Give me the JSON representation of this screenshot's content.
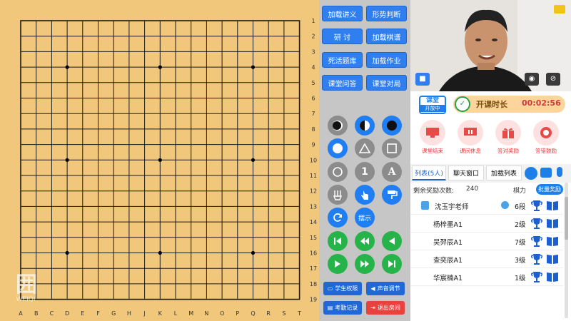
{
  "board": {
    "col_labels": [
      "A",
      "B",
      "C",
      "D",
      "E",
      "F",
      "G",
      "H",
      "J",
      "K",
      "L",
      "M",
      "N",
      "O",
      "P",
      "Q",
      "R",
      "S",
      "T"
    ],
    "row_labels": [
      "1",
      "2",
      "3",
      "4",
      "5",
      "6",
      "7",
      "8",
      "9",
      "10",
      "11",
      "12",
      "13",
      "14",
      "15",
      "16",
      "17",
      "18",
      "19"
    ],
    "star_points": [
      "D4",
      "K4",
      "Q4",
      "D10",
      "K10",
      "Q10",
      "D16",
      "K16",
      "Q16"
    ],
    "board_color": "#f1c77b",
    "line_color": "#1a1a1a"
  },
  "watermark": {
    "text": "少儿围棋",
    "sub": "WEIQI"
  },
  "tools": {
    "buttons": [
      {
        "label": "加载讲义",
        "name": "load-handout-button"
      },
      {
        "label": "形势判断",
        "name": "situation-judge-button"
      },
      {
        "label": "研 讨",
        "name": "discuss-button"
      },
      {
        "label": "加载棋谱",
        "name": "load-record-button"
      },
      {
        "label": "死活题库",
        "name": "life-death-bank-button"
      },
      {
        "label": "加载作业",
        "name": "load-homework-button"
      },
      {
        "label": "课堂问答",
        "name": "class-qa-button"
      },
      {
        "label": "课堂对局",
        "name": "class-game-button"
      }
    ],
    "display_label": "摆示",
    "student_perm": "学生权限",
    "sound_adjust": "声音调节",
    "attendance": "考勤记录",
    "exit_room": "退出房间",
    "blue": "#2f7ff0",
    "green": "#25b34a",
    "grey": "#8c8c8c",
    "red": "#e8423f"
  },
  "timer": {
    "badge_top": "课堂",
    "badge_bottom": "开放中",
    "label": "开课时长",
    "time": "00:02:56"
  },
  "rewards": [
    {
      "label": "课堂结束",
      "name": "class-end-button"
    },
    {
      "label": "课间休息",
      "name": "break-button"
    },
    {
      "label": "答对奖励",
      "name": "correct-reward-button"
    },
    {
      "label": "答错鼓励",
      "name": "wrong-encourage-button"
    }
  ],
  "tabs": {
    "list": "列表(5人)",
    "chat": "聊天窗口",
    "load_list": "加载列表"
  },
  "reward_count": {
    "label": "剩余奖励次数:",
    "value": "240",
    "rank_header": "棋力",
    "all_reward": "批量奖励"
  },
  "students": [
    {
      "name": "沈玉宇老师",
      "rank": "6段",
      "teacher": true
    },
    {
      "name": "杨梓墨A1",
      "rank": "2级",
      "teacher": false
    },
    {
      "name": "吴羿辰A1",
      "rank": "7级",
      "teacher": false
    },
    {
      "name": "查奕辰A1",
      "rank": "3级",
      "teacher": false
    },
    {
      "name": "华宸楠A1",
      "rank": "1级",
      "teacher": false
    }
  ]
}
